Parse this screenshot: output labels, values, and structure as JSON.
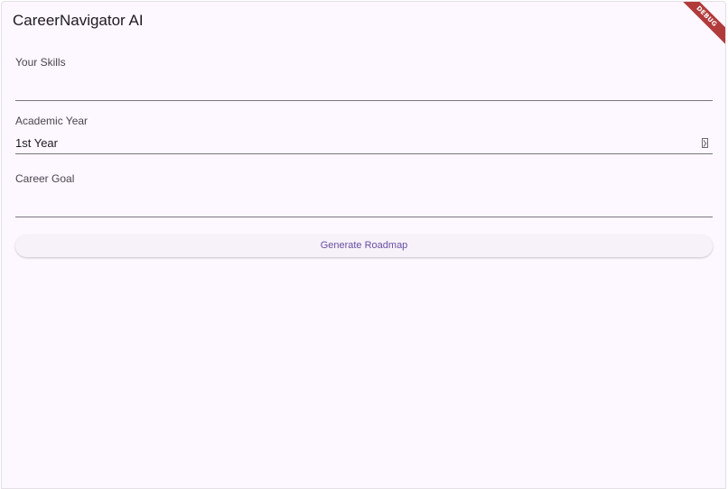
{
  "app": {
    "title": "CareerNavigator AI",
    "debug_badge": "DEBUG"
  },
  "form": {
    "skills": {
      "label": "Your Skills",
      "value": ""
    },
    "academic_year": {
      "label": "Academic Year",
      "selected": "1st Year",
      "icon": "dropdown-arrow-icon"
    },
    "career_goal": {
      "label": "Career Goal",
      "value": ""
    },
    "generate_label": "Generate Roadmap"
  },
  "colors": {
    "background": "#fdf7ff",
    "button_text": "#6750a4",
    "debug_ribbon": "#b13b3b"
  }
}
